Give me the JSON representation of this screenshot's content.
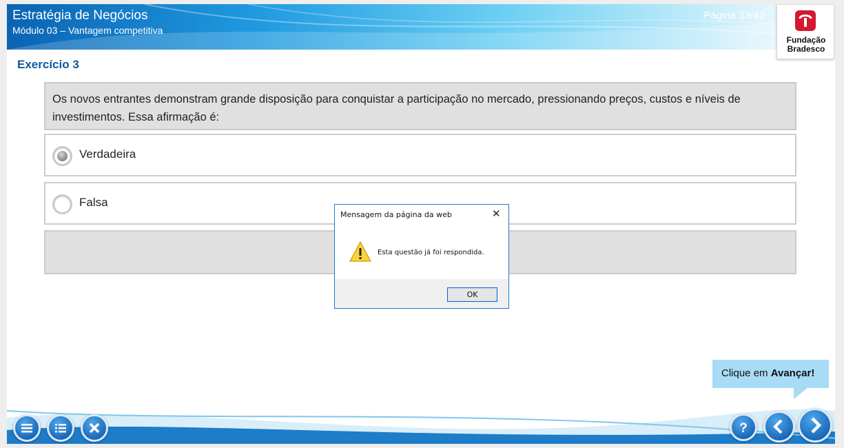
{
  "header": {
    "course_title": "Estratégia de Negócios",
    "module_title": "Módulo 03 – Vantagem competitiva",
    "page_label": "Página 33/42",
    "logo_line1": "Fundação",
    "logo_line2": "Bradesco"
  },
  "exercise": {
    "title": "Exercício 3",
    "question": "Os novos entrantes demonstram grande disposição para conquistar a participação no mercado, pressionando preços, custos e níveis de investimentos. Essa afirmação é:",
    "options": [
      {
        "label": "Verdadeira",
        "selected": true
      },
      {
        "label": "Falsa",
        "selected": false
      }
    ]
  },
  "tooltip": {
    "prefix": "Clique em ",
    "action": "Avançar!"
  },
  "footer": {
    "help_label": "?"
  },
  "dialog": {
    "title": "Mensagem da página da web",
    "close_glyph": "✕",
    "message": "Esta questão já foi respondida.",
    "ok_label": "OK"
  },
  "colors": {
    "title_blue": "#0d5aa0",
    "nav_blue": "#1766b8",
    "tooltip_bg": "#a8dbf6",
    "option_border": "#cccccc"
  }
}
